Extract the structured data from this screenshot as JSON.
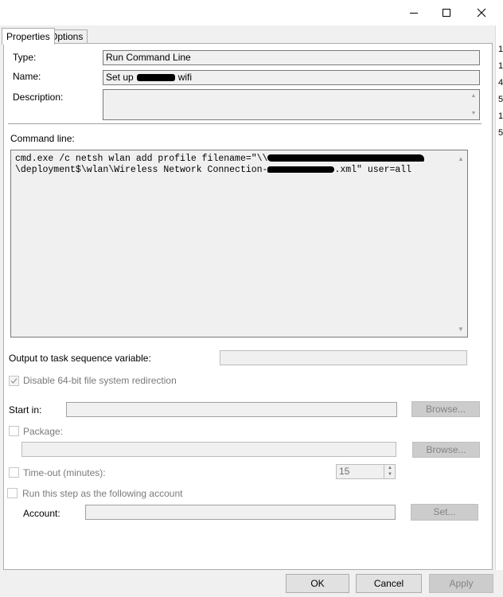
{
  "window": {
    "controls": {
      "minimize_icon": "minimize-icon",
      "maximize_icon": "maximize-icon",
      "close_icon": "close-icon"
    },
    "right_strip_digits": [
      "1",
      "1",
      "4",
      "5",
      "1",
      "5"
    ]
  },
  "tabs": [
    {
      "label": "Properties",
      "active": true
    },
    {
      "label": "Options",
      "active": false
    }
  ],
  "properties": {
    "type_label": "Type:",
    "type_value": "Run Command Line",
    "name_label": "Name:",
    "name_value_prefix": "Set up",
    "name_value_suffix": "wifi",
    "description_label": "Description:",
    "description_value": "",
    "command_line_label": "Command line:",
    "command_line_line1_a": "cmd.exe /c netsh wlan add profile filename=\"\\\\",
    "command_line_line2_a": "\\deployment$\\wlan\\Wireless Network Connection-",
    "command_line_line2_b": ".xml\" user=all",
    "output_var_label": "Output to task sequence variable:",
    "output_var_value": "",
    "disable_redirect_label": "Disable 64-bit file system redirection",
    "disable_redirect_checked": true,
    "start_in_label": "Start in:",
    "start_in_value": "",
    "browse_label": "Browse...",
    "package_label": "Package:",
    "package_checked": false,
    "package_value": "",
    "package_browse_label": "Browse...",
    "timeout_label": "Time-out (minutes):",
    "timeout_checked": false,
    "timeout_value": "15",
    "run_as_label": "Run this step as the following account",
    "run_as_checked": false,
    "account_label": "Account:",
    "account_value": "",
    "set_label": "Set..."
  },
  "footer": {
    "ok_label": "OK",
    "cancel_label": "Cancel",
    "apply_label": "Apply"
  },
  "colors": {
    "window_bg": "#f0f0f0",
    "panel_bg": "#ffffff",
    "disabled_text": "#7a7a7a"
  }
}
